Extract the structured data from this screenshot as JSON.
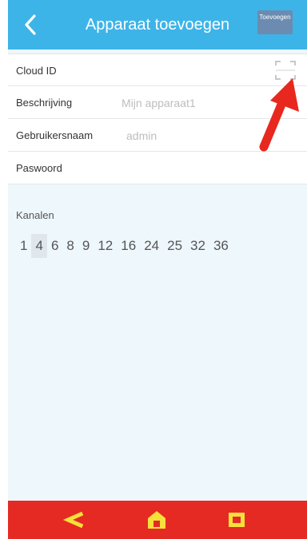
{
  "header": {
    "title": "Apparaat toevoegen",
    "add_button": "Toevoegen"
  },
  "form": {
    "cloud_id": {
      "label": "Cloud ID",
      "value": "",
      "placeholder": ""
    },
    "description": {
      "label": "Beschrijving",
      "value": "",
      "placeholder": "Mijn apparaat1"
    },
    "username": {
      "label": "Gebruikersnaam",
      "value": "",
      "placeholder": "admin"
    },
    "password": {
      "label": "Paswoord",
      "value": "",
      "placeholder": ""
    }
  },
  "channels": {
    "label": "Kanalen",
    "options": [
      "1",
      "4",
      "6",
      "8",
      "9",
      "12",
      "16",
      "24",
      "25",
      "32",
      "36"
    ],
    "selected": "4"
  },
  "icons": {
    "back": "chevron-left-icon",
    "scan": "qr-scan-icon",
    "annotation": "red-arrow-icon",
    "nav_back": "back-icon",
    "nav_home": "home-icon",
    "nav_recent": "recent-apps-icon"
  },
  "colors": {
    "header": "#3db4e8",
    "background": "#eef7fc",
    "navbar": "#e52a24",
    "nav_icon": "#f6e03a",
    "annotation_arrow": "#e8281e"
  }
}
